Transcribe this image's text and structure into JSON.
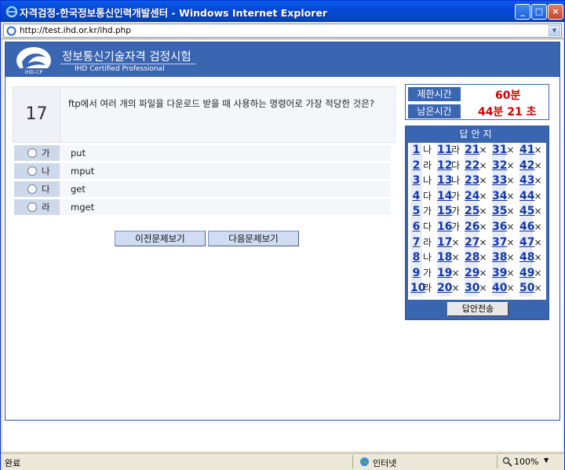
{
  "window": {
    "title": "자격검정-한국정보통신인력개발센터 - Windows Internet Explorer",
    "url": "http://test.ihd.or.kr/ihd.php"
  },
  "header": {
    "korean_title": "정보통신기술자격  검정시험",
    "english_title": "IHD Certified Professional",
    "logo_text": "IHD-CP"
  },
  "question": {
    "number": "17",
    "text": "ftp에서 여러 개의 파일을 다운로드 받을 때 사용하는 명령어로 가장 적당한 것은?"
  },
  "options": [
    {
      "letter": "가",
      "text": "put"
    },
    {
      "letter": "나",
      "text": "mput"
    },
    {
      "letter": "다",
      "text": "get"
    },
    {
      "letter": "라",
      "text": "mget"
    }
  ],
  "nav": {
    "prev": "이전문제보기",
    "next": "다음문제보기"
  },
  "time": {
    "limit_label": "제한시간",
    "limit_value": "60분",
    "remain_label": "남은시간",
    "remain_value": "44분 21 초"
  },
  "answer_sheet": {
    "title": "답안지",
    "submit": "답안전송",
    "rows": [
      [
        {
          "n": "1",
          "a": "나"
        },
        {
          "n": "11",
          "a": "라"
        },
        {
          "n": "21",
          "a": "×"
        },
        {
          "n": "31",
          "a": "×"
        },
        {
          "n": "41",
          "a": "×"
        }
      ],
      [
        {
          "n": "2",
          "a": "라"
        },
        {
          "n": "12",
          "a": "다"
        },
        {
          "n": "22",
          "a": "×"
        },
        {
          "n": "32",
          "a": "×"
        },
        {
          "n": "42",
          "a": "×"
        }
      ],
      [
        {
          "n": "3",
          "a": "나"
        },
        {
          "n": "13",
          "a": "나"
        },
        {
          "n": "23",
          "a": "×"
        },
        {
          "n": "33",
          "a": "×"
        },
        {
          "n": "43",
          "a": "×"
        }
      ],
      [
        {
          "n": "4",
          "a": "다"
        },
        {
          "n": "14",
          "a": "가"
        },
        {
          "n": "24",
          "a": "×"
        },
        {
          "n": "34",
          "a": "×"
        },
        {
          "n": "44",
          "a": "×"
        }
      ],
      [
        {
          "n": "5",
          "a": "가"
        },
        {
          "n": "15",
          "a": "가"
        },
        {
          "n": "25",
          "a": "×"
        },
        {
          "n": "35",
          "a": "×"
        },
        {
          "n": "45",
          "a": "×"
        }
      ],
      [
        {
          "n": "6",
          "a": "다"
        },
        {
          "n": "16",
          "a": "가"
        },
        {
          "n": "26",
          "a": "×"
        },
        {
          "n": "36",
          "a": "×"
        },
        {
          "n": "46",
          "a": "×"
        }
      ],
      [
        {
          "n": "7",
          "a": "라"
        },
        {
          "n": "17",
          "a": "×"
        },
        {
          "n": "27",
          "a": "×"
        },
        {
          "n": "37",
          "a": "×"
        },
        {
          "n": "47",
          "a": "×"
        }
      ],
      [
        {
          "n": "8",
          "a": "나"
        },
        {
          "n": "18",
          "a": "×"
        },
        {
          "n": "28",
          "a": "×"
        },
        {
          "n": "38",
          "a": "×"
        },
        {
          "n": "48",
          "a": "×"
        }
      ],
      [
        {
          "n": "9",
          "a": "가"
        },
        {
          "n": "19",
          "a": "×"
        },
        {
          "n": "29",
          "a": "×"
        },
        {
          "n": "39",
          "a": "×"
        },
        {
          "n": "49",
          "a": "×"
        }
      ],
      [
        {
          "n": "10",
          "a": "라"
        },
        {
          "n": "20",
          "a": "×"
        },
        {
          "n": "30",
          "a": "×"
        },
        {
          "n": "40",
          "a": "×"
        },
        {
          "n": "50",
          "a": "×"
        }
      ]
    ]
  },
  "status": {
    "left": "완료",
    "zone": "인터넷",
    "zoom": "100%"
  },
  "colors": {
    "header": "#3a65b0",
    "remaining_time": "#d00000",
    "number_link": "#1238a8"
  }
}
